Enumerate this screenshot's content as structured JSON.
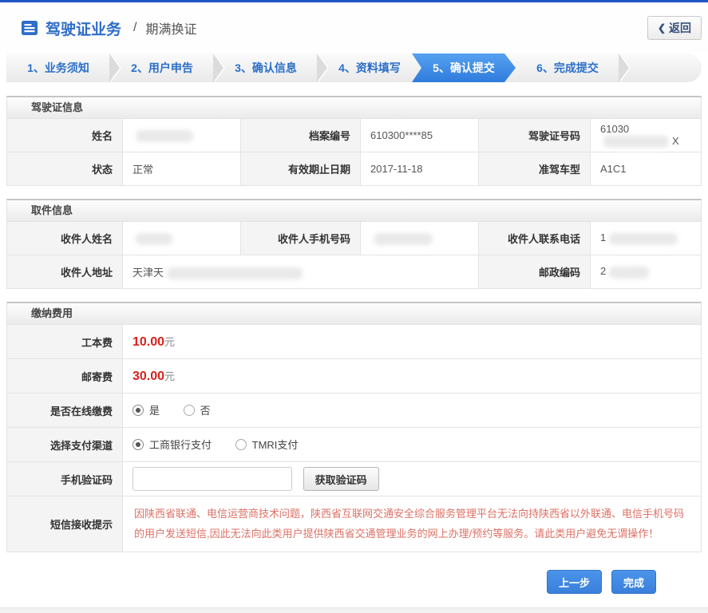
{
  "header": {
    "title": "驾驶证业务",
    "separator": "/",
    "subtitle": "期满换证",
    "back_chevron": "❮",
    "back_label": "返回"
  },
  "steps": {
    "items": [
      {
        "label": "1、业务须知",
        "active": false
      },
      {
        "label": "2、用户申告",
        "active": false
      },
      {
        "label": "3、确认信息",
        "active": false
      },
      {
        "label": "4、资料填写",
        "active": false
      },
      {
        "label": "5、确认提交",
        "active": true
      },
      {
        "label": "6、完成提交",
        "active": false
      }
    ]
  },
  "license_section": {
    "title": "驾驶证信息",
    "name_label": "姓名",
    "file_no_label": "档案编号",
    "file_no_value": "610300****85",
    "license_no_label": "驾驶证号码",
    "license_no_prefix": "61030",
    "license_no_suffix": "X",
    "status_label": "状态",
    "status_value": "正常",
    "expiry_label": "有效期止日期",
    "expiry_value": "2017-11-18",
    "vehicle_class_label": "准驾车型",
    "vehicle_class_value": "A1C1"
  },
  "pickup_section": {
    "title": "取件信息",
    "recipient_name_label": "收件人姓名",
    "recipient_mobile_label": "收件人手机号码",
    "recipient_phone_label": "收件人联系电话",
    "recipient_phone_prefix": "1",
    "recipient_address_label": "收件人地址",
    "recipient_address_prefix": "天津天",
    "postal_code_label": "邮政编码",
    "postal_code_prefix": "2"
  },
  "payment_section": {
    "title": "缴纳费用",
    "production_fee_label": "工本费",
    "production_fee_value": "10.00",
    "postage_fee_label": "邮寄费",
    "postage_fee_value": "30.00",
    "fee_unit": "元",
    "online_payment_label": "是否在线缴费",
    "online_yes": "是",
    "online_no": "否",
    "channel_label": "选择支付渠道",
    "channel_icbc": "工商银行支付",
    "channel_tmri": "TMRI支付",
    "sms_code_label": "手机验证码",
    "sms_code_value": "",
    "get_code_button": "获取验证码",
    "sms_notice_label": "短信接收提示",
    "sms_notice_text": "因陕西省联通、电信运营商技术问题，陕西省互联网交通安全综合服务管理平台无法向持陕西省以外联通、电信手机号码的用户发送短信,因此无法向此类用户提供陕西省交通管理业务的网上办理/预约等服务。请此类用户避免无谓操作！"
  },
  "actions": {
    "prev_label": "上一步",
    "finish_label": "完成"
  },
  "colors": {
    "top_bar_blue": "#1f57c5",
    "accent_blue": "#2e6dc9",
    "active_step_blue": "#3686e8",
    "fee_red": "#d9211c",
    "notice_red": "#dd7166",
    "button_blue": "#3d86e0"
  }
}
